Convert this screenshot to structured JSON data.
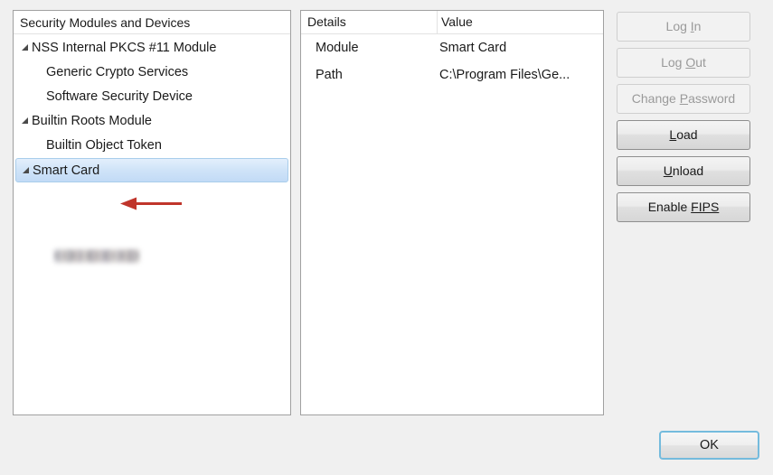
{
  "tree_panel": {
    "header": "Security Modules and Devices",
    "items": [
      {
        "label": "NSS Internal PKCS #11 Module",
        "level": 0,
        "expander": true,
        "selected": false,
        "redacted": false
      },
      {
        "label": "Generic Crypto Services",
        "level": 1,
        "expander": false,
        "selected": false,
        "redacted": false
      },
      {
        "label": "Software Security Device",
        "level": 1,
        "expander": false,
        "selected": false,
        "redacted": false
      },
      {
        "label": "Builtin Roots Module",
        "level": 0,
        "expander": true,
        "selected": false,
        "redacted": false
      },
      {
        "label": "Builtin Object Token",
        "level": 1,
        "expander": false,
        "selected": false,
        "redacted": false
      },
      {
        "label": "Smart Card",
        "level": 0,
        "expander": true,
        "selected": true,
        "redacted": false
      }
    ],
    "redacted_item": {
      "label": "",
      "description": "blurred-redacted-token-name"
    },
    "annotation": {
      "icon": "red-left-arrow",
      "color": "#c0352b",
      "points_to": "Smart Card"
    }
  },
  "details_panel": {
    "columns": [
      "Details",
      "Value"
    ],
    "rows": [
      {
        "label": "Module",
        "value": "Smart Card"
      },
      {
        "label": "Path",
        "value": "C:\\Program Files\\Ge..."
      }
    ]
  },
  "buttons": {
    "side": [
      {
        "prefix": "Log ",
        "accel": "I",
        "suffix": "n",
        "enabled": false
      },
      {
        "prefix": "Log ",
        "accel": "O",
        "suffix": "ut",
        "enabled": false
      },
      {
        "prefix": "Change ",
        "accel": "P",
        "suffix": "assword",
        "enabled": false
      },
      {
        "prefix": "",
        "accel": "L",
        "suffix": "oad",
        "enabled": true
      },
      {
        "prefix": "",
        "accel": "U",
        "suffix": "nload",
        "enabled": true
      },
      {
        "prefix": "Enable ",
        "accel": "FIPS",
        "suffix": "",
        "enabled": true
      }
    ],
    "ok": "OK"
  },
  "colors": {
    "window_background": "#f0f0f0",
    "panel_background": "#ffffff",
    "panel_border": "#a0a0a0",
    "selection_start": "#e3effc",
    "selection_end": "#c2dbf6",
    "selection_border": "#a9cdeb",
    "arrow_red": "#c0352b",
    "focus_ring": "#74bbdd",
    "disabled_text": "#9a9a9a"
  }
}
